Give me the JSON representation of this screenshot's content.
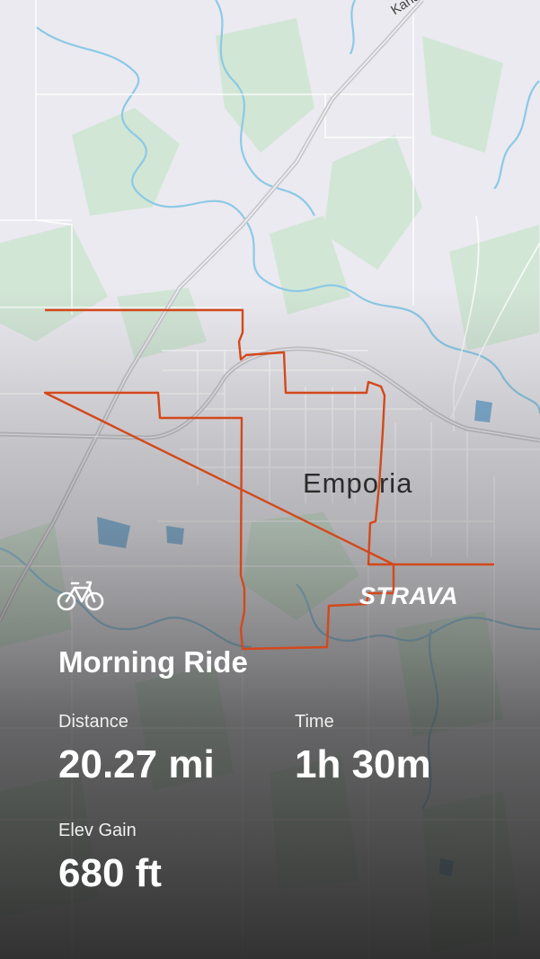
{
  "map": {
    "city_label": "Emporia",
    "road_label": "Kans",
    "route_color": "#d4481b"
  },
  "activity": {
    "type_icon": "bicycle-icon",
    "title": "Morning Ride",
    "brand": "STRAVA",
    "stats": [
      {
        "label": "Distance",
        "value": "20.27 mi"
      },
      {
        "label": "Time",
        "value": "1h 30m"
      },
      {
        "label": "Elev Gain",
        "value": "680 ft"
      }
    ]
  },
  "colors": {
    "map_background": "#ebeaf0",
    "park_green": "#cfe6d3",
    "river_blue": "#8cc9e6",
    "text": "#ffffff"
  }
}
